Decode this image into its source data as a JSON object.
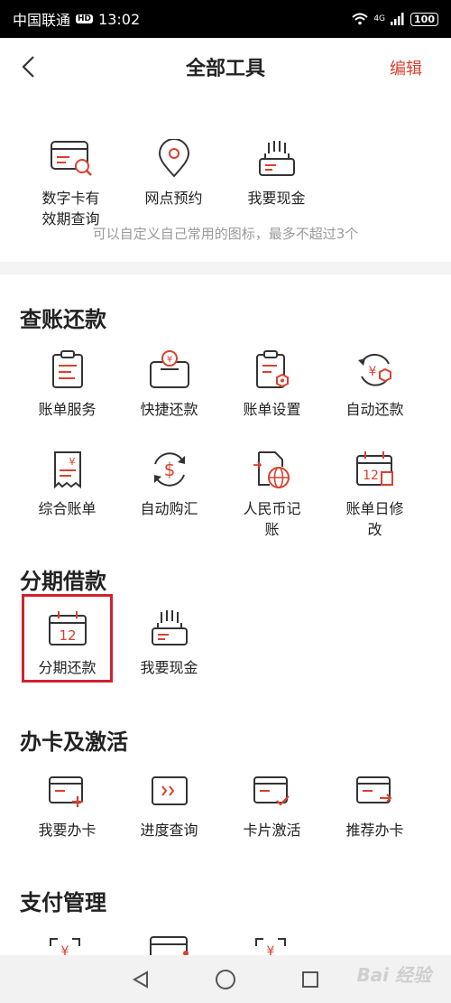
{
  "status_bar": {
    "carrier": "中国联通",
    "hd": "HD",
    "time": "13:02",
    "network": "4G",
    "battery": "100"
  },
  "nav": {
    "title": "全部工具",
    "edit_label": "编辑"
  },
  "favorites": {
    "items": [
      {
        "label": "数字卡有\n效期查询",
        "icon": "card-search-icon"
      },
      {
        "label": "网点预约",
        "icon": "location-pin-icon"
      },
      {
        "label": "我要现金",
        "icon": "cash-hand-icon"
      }
    ],
    "note": "可以自定义自己常用的图标，最多不超过3个"
  },
  "sections": {
    "billing": {
      "title": "查账还款",
      "items": [
        {
          "label": "账单服务",
          "icon": "bill-icon"
        },
        {
          "label": "快捷还款",
          "icon": "quick-repay-icon"
        },
        {
          "label": "账单设置",
          "icon": "bill-settings-icon"
        },
        {
          "label": "自动还款",
          "icon": "auto-repay-icon"
        },
        {
          "label": "综合账单",
          "icon": "receipt-icon"
        },
        {
          "label": "自动购汇",
          "icon": "currency-exchange-icon"
        },
        {
          "label": "人民币记\n账",
          "icon": "globe-doc-icon"
        },
        {
          "label": "账单日修\n改",
          "icon": "calendar-edit-icon"
        }
      ]
    },
    "installment": {
      "title": "分期借款",
      "items": [
        {
          "label": "分期还款",
          "icon": "calendar-12-icon"
        },
        {
          "label": "我要现金",
          "icon": "cash-hand-icon"
        }
      ]
    },
    "card": {
      "title": "办卡及激活",
      "items": [
        {
          "label": "我要办卡",
          "icon": "card-add-icon"
        },
        {
          "label": "进度查询",
          "icon": "progress-query-icon"
        },
        {
          "label": "卡片激活",
          "icon": "card-activate-icon"
        },
        {
          "label": "推荐办卡",
          "icon": "card-recommend-icon"
        }
      ]
    },
    "payment": {
      "title": "支付管理"
    }
  },
  "watermark": "Bai 经验",
  "colors": {
    "accent": "#d9412f",
    "highlight_border": "#d0212e",
    "icon_stroke": "#333333"
  }
}
